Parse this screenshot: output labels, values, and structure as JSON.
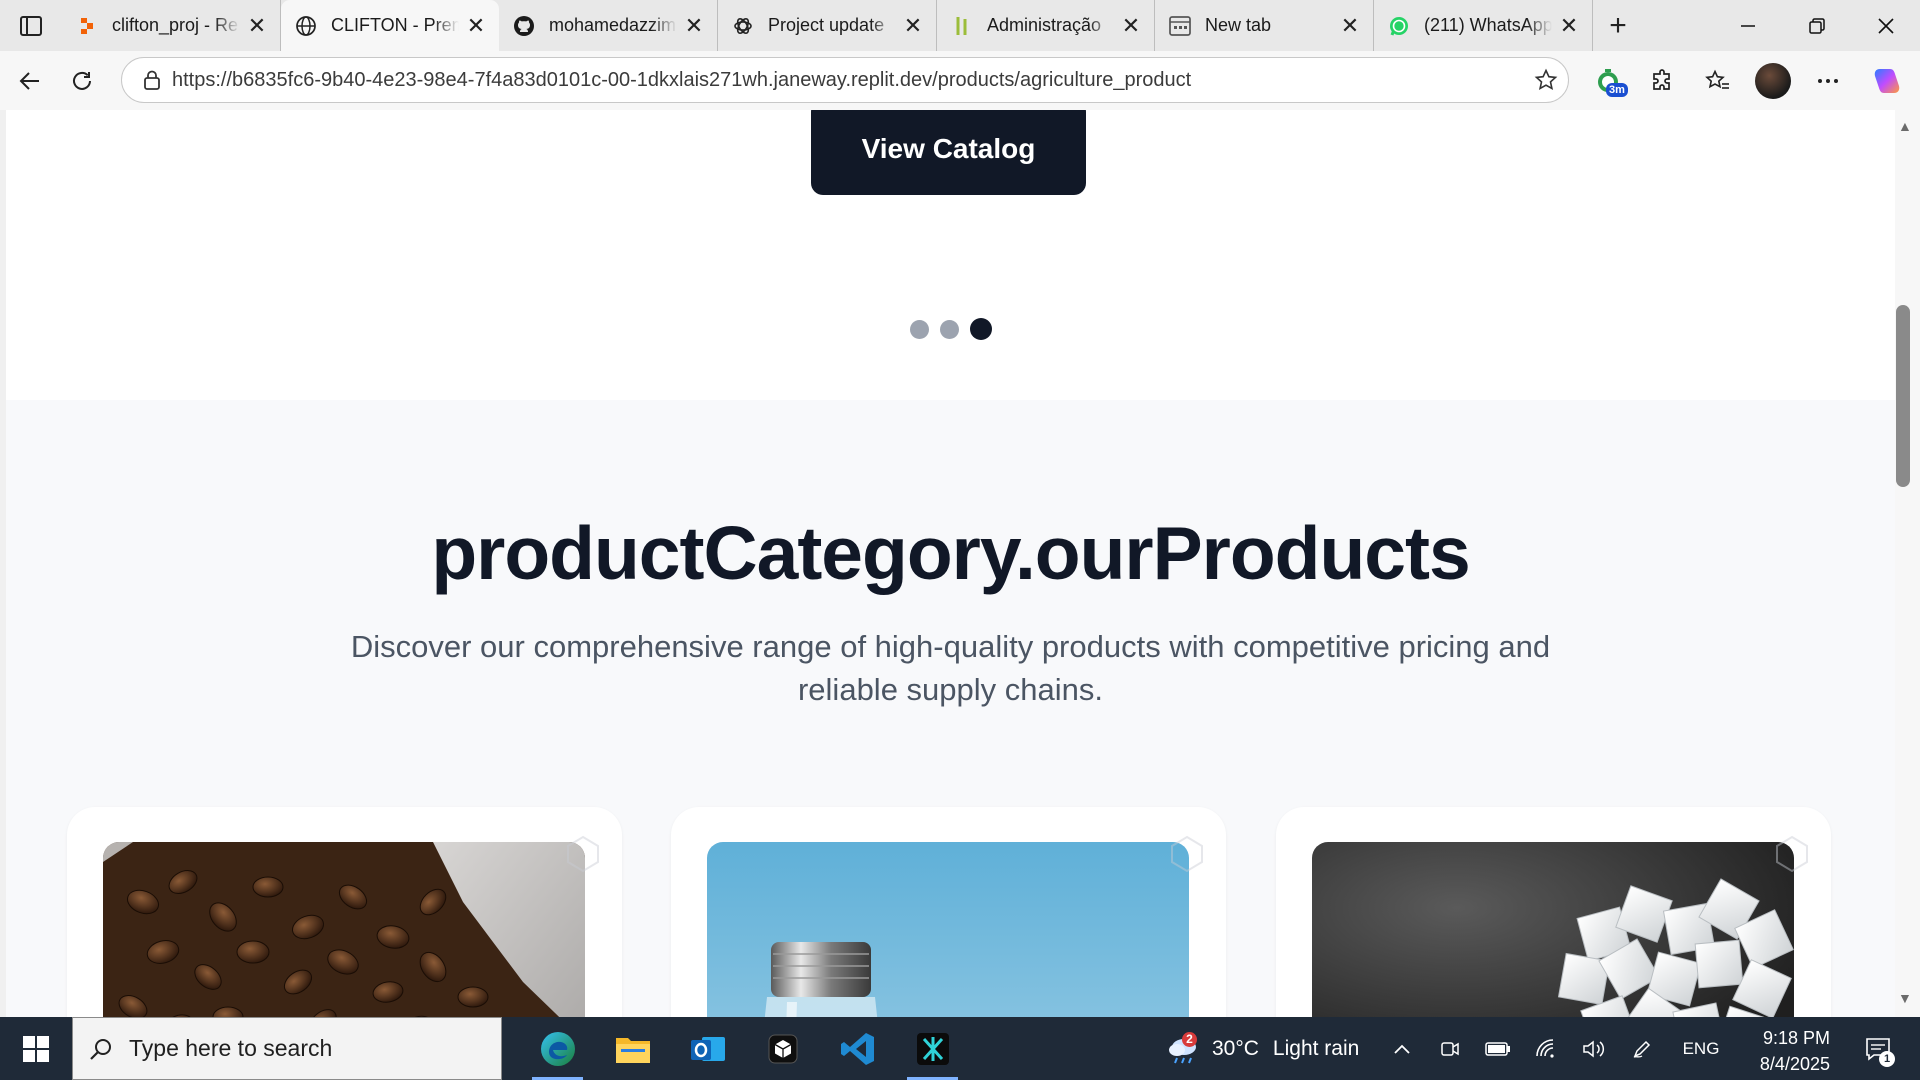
{
  "browser": {
    "tabs": [
      {
        "label": "clifton_proj - Re",
        "icon": "replit-icon",
        "active": false
      },
      {
        "label": "CLIFTON - Prem",
        "icon": "globe-icon",
        "active": true
      },
      {
        "label": "mohamedazzim",
        "icon": "github-icon",
        "active": false
      },
      {
        "label": "Project update",
        "icon": "openai-icon",
        "active": false
      },
      {
        "label": "Administração",
        "icon": "bamboo-icon",
        "active": false
      },
      {
        "label": "New tab",
        "icon": "newtab-page-icon",
        "active": false
      },
      {
        "label": "(211) WhatsApp",
        "icon": "whatsapp-icon",
        "active": false
      }
    ],
    "close_glyph": "✕",
    "new_tab_glyph": "+",
    "url": "https://b6835fc6-9b40-4e23-98e4-7f4a83d0101c-00-1dkxlais271wh.janeway.replit.dev/products/agriculture_product",
    "extension_badge": "3m"
  },
  "page": {
    "cta_label": "View Catalog",
    "carousel": {
      "count": 3,
      "active_index": 2
    },
    "section_title": "productCategory.ourProducts",
    "section_subtitle": "Discover our comprehensive range of high-quality products with competitive pricing and reliable supply chains.",
    "cards": [
      {
        "image": "coffee-beans"
      },
      {
        "image": "glass-bottle"
      },
      {
        "image": "sugar-cubes"
      }
    ]
  },
  "taskbar": {
    "search_placeholder": "Type here to search",
    "weather_temp": "30°C",
    "weather_desc": "Light rain",
    "weather_badge": "2",
    "language": "ENG",
    "time": "9:18 PM",
    "date": "8/4/2025",
    "notification_count": "1"
  },
  "colors": {
    "primary_dark": "#111827",
    "muted_text": "#4b5563",
    "page_bg": "#f8f9fb",
    "taskbar_bg": "#1f2a38"
  }
}
